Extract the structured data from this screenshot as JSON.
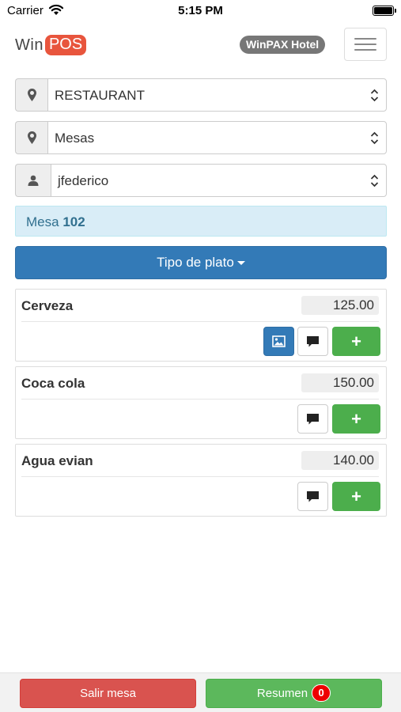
{
  "status_bar": {
    "carrier": "Carrier",
    "time": "5:15 PM"
  },
  "header": {
    "logo_part1": "Win",
    "logo_part2": "POS",
    "hotel": "WinPAX Hotel"
  },
  "selects": {
    "area": "RESTAURANT",
    "section": "Mesas",
    "user": "jfederico"
  },
  "mesa": {
    "prefix": "Mesa",
    "number": "102"
  },
  "category_button": "Tipo de plato",
  "products": [
    {
      "name": "Cerveza",
      "price": "125.00",
      "has_image": true
    },
    {
      "name": "Coca cola",
      "price": "150.00",
      "has_image": false
    },
    {
      "name": "Agua evian",
      "price": "140.00",
      "has_image": false
    }
  ],
  "footer": {
    "exit_label": "Salir mesa",
    "summary_label": "Resumen",
    "summary_count": "0"
  },
  "colors": {
    "primary": "#337ab7",
    "success": "#5cb85c",
    "danger": "#d9534f",
    "info_bg": "#d9edf7",
    "logo_accent": "#e8553d"
  }
}
